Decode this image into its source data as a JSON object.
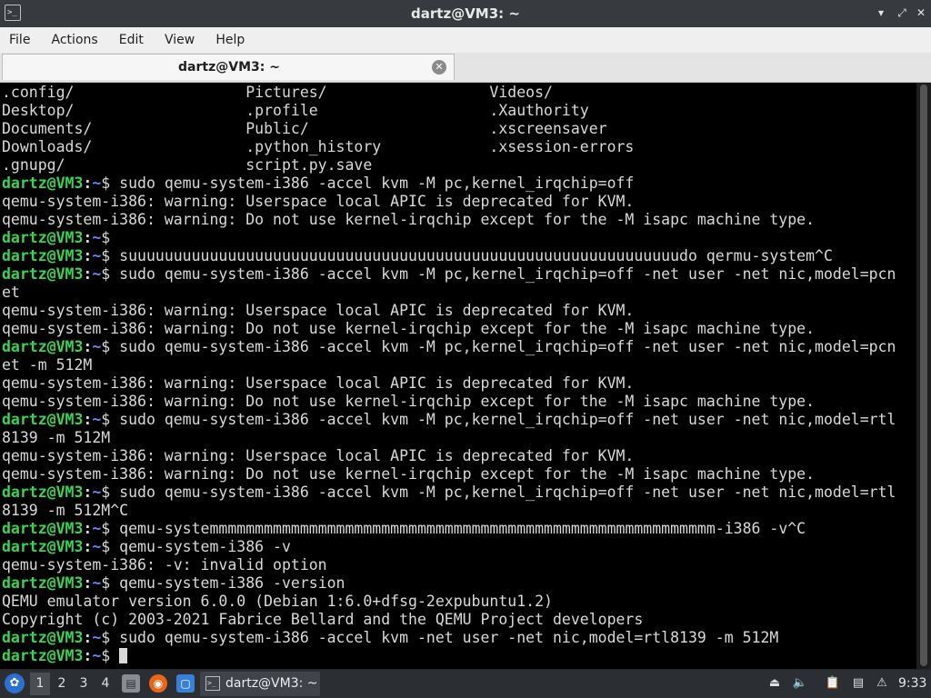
{
  "window": {
    "title": "dartz@VM3: ~",
    "icon": "terminal-icon",
    "controls": [
      "minimize-icon",
      "maximize-icon",
      "close-icon"
    ]
  },
  "menu": [
    "File",
    "Actions",
    "Edit",
    "View",
    "Help"
  ],
  "tab": {
    "label": "dartz@VM3: ~",
    "close_icon": "close-circle-icon"
  },
  "terminal": {
    "prompt_user": "dartz@VM3",
    "prompt_colon": ":",
    "prompt_path": "~",
    "lines": [
      {
        "type": "out",
        "text": ".config/                   Pictures/                  Videos/"
      },
      {
        "type": "out",
        "text": "Desktop/                   .profile                   .Xauthority"
      },
      {
        "type": "out",
        "text": "Documents/                 Public/                    .xscreensaver"
      },
      {
        "type": "out",
        "text": "Downloads/                 .python_history            .xsession-errors"
      },
      {
        "type": "out",
        "text": ".gnupg/                    script.py.save"
      },
      {
        "type": "cmd",
        "text": "$ sudo qemu-system-i386 -accel kvm -M pc,kernel_irqchip=off"
      },
      {
        "type": "out",
        "text": "qemu-system-i386: warning: Userspace local APIC is deprecated for KVM."
      },
      {
        "type": "out",
        "text": "qemu-system-i386: warning: Do not use kernel-irqchip except for the -M isapc machine type."
      },
      {
        "type": "cmd",
        "text": "$ "
      },
      {
        "type": "cmd",
        "text": "$ suuuuuuuuuuuuuuuuuuuuuuuuuuuuuuuuuuuuuuuuuuuuuuuuuuuuuuuuuuuuudo qermu-system^C"
      },
      {
        "type": "cmd",
        "text": "$ sudo qemu-system-i386 -accel kvm -M pc,kernel_irqchip=off -net user -net nic,model=pcn"
      },
      {
        "type": "out",
        "text": "et"
      },
      {
        "type": "out",
        "text": "qemu-system-i386: warning: Userspace local APIC is deprecated for KVM."
      },
      {
        "type": "out",
        "text": "qemu-system-i386: warning: Do not use kernel-irqchip except for the -M isapc machine type."
      },
      {
        "type": "cmd",
        "text": "$ sudo qemu-system-i386 -accel kvm -M pc,kernel_irqchip=off -net user -net nic,model=pcn"
      },
      {
        "type": "out",
        "text": "et -m 512M"
      },
      {
        "type": "out",
        "text": "qemu-system-i386: warning: Userspace local APIC is deprecated for KVM."
      },
      {
        "type": "out",
        "text": "qemu-system-i386: warning: Do not use kernel-irqchip except for the -M isapc machine type."
      },
      {
        "type": "cmd",
        "text": "$ sudo qemu-system-i386 -accel kvm -M pc,kernel_irqchip=off -net user -net nic,model=rtl"
      },
      {
        "type": "out",
        "text": "8139 -m 512M"
      },
      {
        "type": "out",
        "text": "qemu-system-i386: warning: Userspace local APIC is deprecated for KVM."
      },
      {
        "type": "out",
        "text": "qemu-system-i386: warning: Do not use kernel-irqchip except for the -M isapc machine type."
      },
      {
        "type": "cmd",
        "text": "$ sudo qemu-system-i386 -accel kvm -M pc,kernel_irqchip=off -net user -net nic,model=rtl"
      },
      {
        "type": "out",
        "text": "8139 -m 512M^C"
      },
      {
        "type": "cmd",
        "text": "$ qemu-systemmmmmmmmmmmmmmmmmmmmmmmmmmmmmmmmmmmmmmmmmmmmmmmmmmmmmmmm-i386 -v^C"
      },
      {
        "type": "cmd",
        "text": "$ qemu-system-i386 -v"
      },
      {
        "type": "out",
        "text": "qemu-system-i386: -v: invalid option"
      },
      {
        "type": "cmd",
        "text": "$ qemu-system-i386 -version"
      },
      {
        "type": "out",
        "text": "QEMU emulator version 6.0.0 (Debian 1:6.0+dfsg-2expubuntu1.2)"
      },
      {
        "type": "out",
        "text": "Copyright (c) 2003-2021 Fabrice Bellard and the QEMU Project developers"
      },
      {
        "type": "cmd",
        "text": "$ sudo qemu-system-i386 -accel kvm -net user -net nic,model=rtl8139 -m 512M"
      },
      {
        "type": "cmd",
        "text": "$ ",
        "cursor": true
      }
    ]
  },
  "taskbar": {
    "start_icon": "lubuntu-start-icon",
    "workspaces": [
      "1",
      "2",
      "3",
      "4"
    ],
    "active_workspace": "1",
    "launchers": [
      "file-manager-icon",
      "firefox-icon",
      "desktop-icon"
    ],
    "task_label": "dartz@VM3: ~",
    "tray_icons": [
      "eject-icon",
      "volume-icon",
      "clipboard-icon",
      "network-icon",
      "update-notifier-icon"
    ],
    "clock": "9:33"
  },
  "colors": {
    "prompt_user": "#39d353",
    "prompt_path": "#5a8cff",
    "terminal_bg": "#000000",
    "terminal_fg": "#d8d8d8"
  }
}
